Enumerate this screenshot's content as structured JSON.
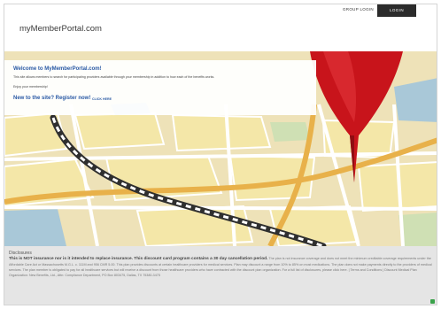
{
  "header": {
    "group_login": "GROUP LOGIN",
    "login": "LOGIN",
    "logo": "myMemberPortal.com"
  },
  "welcome": {
    "title": "Welcome to MyMemberPortal.com!",
    "description": "This site allows members to search for participating providers available through your membership in addition to how each of the benefits works.",
    "enjoy": "Enjoy your membership!",
    "new_to_site": "New to the site? Register now!",
    "click_here": "CLICK HERE"
  },
  "disclosures": {
    "title": "Disclosures",
    "bold_text": "This is NOT insurance nor is it intended to replace insurance. This discount card program contains a 30 day cancellation period.",
    "body_text": "The plan is not insurance coverage and does not meet the minimum creditable coverage requirements under the Affordable Care Act or Massachusetts M.G.L. c. 111M and 956 CMR 5.00. This plan provides discounts at certain healthcare providers for medical services. Plan may discount a range from 10% to 85% on most medications. The plan does not make payments directly to the providers of medical services. The plan member is obligated to pay for all healthcare services but will receive a discount from those healthcare providers who have contracted with the discount plan organization. For a full list of disclosures, please click here. | Terms and Conditions | Discount Medical Plan Organization: New Benefits, Ltd., Attn: Compliance Department, PO Box 803475, Dallas, TX 75380-3475"
  },
  "colors": {
    "accent_blue": "#2b5aa5",
    "login_bg": "#2b2b2b",
    "pin_red": "#c8141b",
    "disclosure_bg": "#e5e5e5"
  }
}
